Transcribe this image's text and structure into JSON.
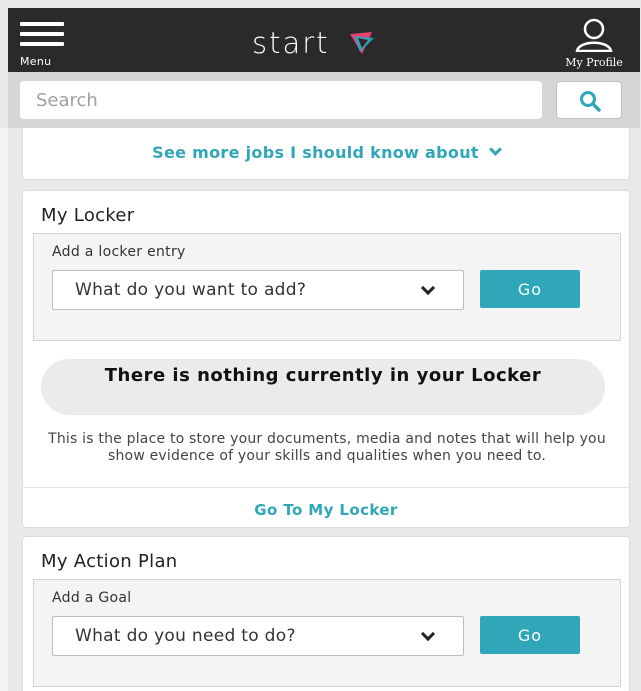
{
  "header": {
    "menu_label": "Menu",
    "logo_text": "start",
    "profile_label": "My Profile"
  },
  "search": {
    "placeholder": "Search"
  },
  "jobs": {
    "see_more_label": "See more jobs I should know about"
  },
  "locker": {
    "title": "My Locker",
    "add_label": "Add a locker entry",
    "select_value": "What do you want to add?",
    "go_label": "Go",
    "empty_title": "There is nothing currently in your Locker",
    "empty_description": "This is the place to store your documents, media and notes that will help you show evidence of your skills and qualities when you need to.",
    "link_label": "Go To My Locker"
  },
  "action_plan": {
    "title": "My Action Plan",
    "add_label": "Add a Goal",
    "select_value": "What do you need to do?",
    "go_label": "Go"
  },
  "colors": {
    "topbar": "#2b2a2a",
    "accent": "#2fa7b8",
    "background": "#e9e9e9"
  },
  "icons": {
    "menu": "hamburger-icon",
    "logo": "start-logo-icon",
    "profile": "user-icon",
    "search": "search-icon",
    "chevron": "chevron-down-icon"
  }
}
